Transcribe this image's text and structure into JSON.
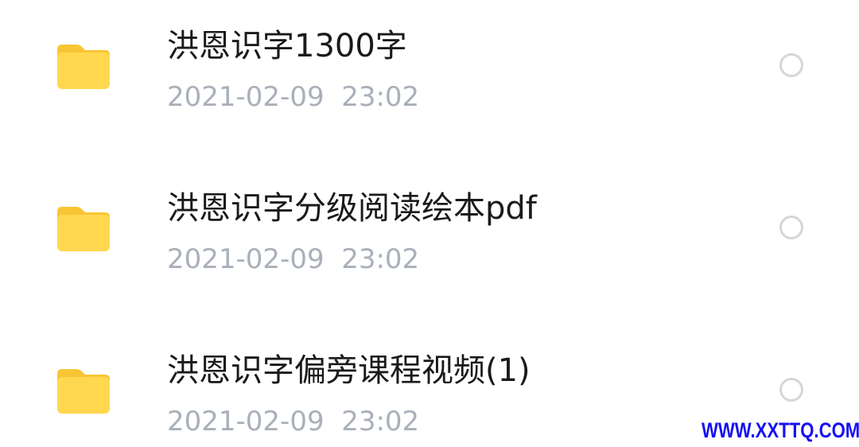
{
  "files": [
    {
      "name": "洪恩识字1300字",
      "date": "2021-02-09  23:02",
      "icon": "folder-icon"
    },
    {
      "name": "洪恩识字分级阅读绘本pdf",
      "date": "2021-02-09  23:02",
      "icon": "folder-icon"
    },
    {
      "name": "洪恩识字偏旁课程视频(1)",
      "date": "2021-02-09  23:02",
      "icon": "folder-icon"
    }
  ],
  "colors": {
    "folder_front": "#FFD84F",
    "folder_back": "#F8C534",
    "name_text": "#1A1A1A",
    "date_text": "#A9B0BA",
    "radio_border": "#D6D6D6",
    "watermark": "#1610F2"
  },
  "watermark": "WWW.XXTTQ.COM"
}
